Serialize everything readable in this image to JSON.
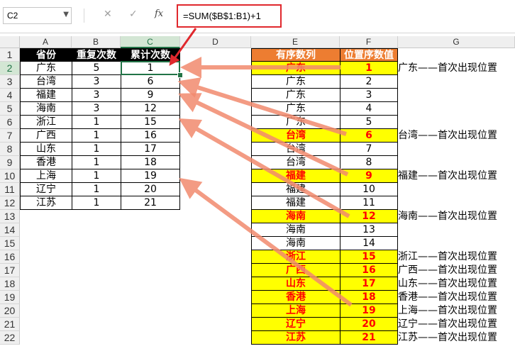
{
  "namebox": {
    "value": "C2"
  },
  "formula_bar": {
    "cancel_icon": "✕",
    "enter_icon": "✓",
    "fx_label": "fx",
    "formula": "=SUM($B$1:B1)+1"
  },
  "columns": [
    "A",
    "B",
    "C",
    "D",
    "E",
    "F",
    "G"
  ],
  "rows": [
    "1",
    "2",
    "3",
    "4",
    "5",
    "6",
    "7",
    "8",
    "9",
    "10",
    "11",
    "12",
    "13",
    "14",
    "15",
    "16",
    "17",
    "18",
    "19",
    "20",
    "21",
    "22"
  ],
  "left_table": {
    "headers": [
      "省份",
      "重复次数",
      "累计次数"
    ],
    "rows": [
      [
        "广东",
        "5",
        "1"
      ],
      [
        "台湾",
        "3",
        "6"
      ],
      [
        "福建",
        "3",
        "9"
      ],
      [
        "海南",
        "3",
        "12"
      ],
      [
        "浙江",
        "1",
        "15"
      ],
      [
        "广西",
        "1",
        "16"
      ],
      [
        "山东",
        "1",
        "17"
      ],
      [
        "香港",
        "1",
        "18"
      ],
      [
        "上海",
        "1",
        "19"
      ],
      [
        "辽宁",
        "1",
        "20"
      ],
      [
        "江苏",
        "1",
        "21"
      ]
    ]
  },
  "right_table": {
    "headers": [
      "有序数列",
      "位置序数值"
    ],
    "rows": [
      {
        "e": "广东",
        "f": "1",
        "hl": true
      },
      {
        "e": "广东",
        "f": "2",
        "hl": false
      },
      {
        "e": "广东",
        "f": "3",
        "hl": false
      },
      {
        "e": "广东",
        "f": "4",
        "hl": false
      },
      {
        "e": "广东",
        "f": "5",
        "hl": false
      },
      {
        "e": "台湾",
        "f": "6",
        "hl": true
      },
      {
        "e": "台湾",
        "f": "7",
        "hl": false
      },
      {
        "e": "台湾",
        "f": "8",
        "hl": false
      },
      {
        "e": "福建",
        "f": "9",
        "hl": true
      },
      {
        "e": "福建",
        "f": "10",
        "hl": false
      },
      {
        "e": "福建",
        "f": "11",
        "hl": false
      },
      {
        "e": "海南",
        "f": "12",
        "hl": true
      },
      {
        "e": "海南",
        "f": "13",
        "hl": false
      },
      {
        "e": "海南",
        "f": "14",
        "hl": false
      },
      {
        "e": "浙江",
        "f": "15",
        "hl": true
      },
      {
        "e": "广西",
        "f": "16",
        "hl": true
      },
      {
        "e": "山东",
        "f": "17",
        "hl": true
      },
      {
        "e": "香港",
        "f": "18",
        "hl": true
      },
      {
        "e": "上海",
        "f": "19",
        "hl": true
      },
      {
        "e": "辽宁",
        "f": "20",
        "hl": true
      },
      {
        "e": "江苏",
        "f": "21",
        "hl": true
      }
    ]
  },
  "notes": [
    {
      "row": 2,
      "text": "广东——首次出现位置"
    },
    {
      "row": 7,
      "text": "台湾——首次出现位置"
    },
    {
      "row": 10,
      "text": "福建——首次出现位置"
    },
    {
      "row": 13,
      "text": "海南——首次出现位置"
    },
    {
      "row": 16,
      "text": "浙江——首次出现位置"
    },
    {
      "row": 17,
      "text": "广西——首次出现位置"
    },
    {
      "row": 18,
      "text": "山东——首次出现位置"
    },
    {
      "row": 19,
      "text": "香港——首次出现位置"
    },
    {
      "row": 20,
      "text": "上海——首次出现位置"
    },
    {
      "row": 21,
      "text": "辽宁——首次出现位置"
    },
    {
      "row": 22,
      "text": "江苏——首次出现位置"
    }
  ],
  "colors": {
    "selection": "#217346",
    "header_black": "#000000",
    "header_orange": "#ed7d31",
    "highlight": "#ffff00",
    "red_text": "#ff0000",
    "arrow": "#f28a6e",
    "formula_border": "#e0282d"
  }
}
